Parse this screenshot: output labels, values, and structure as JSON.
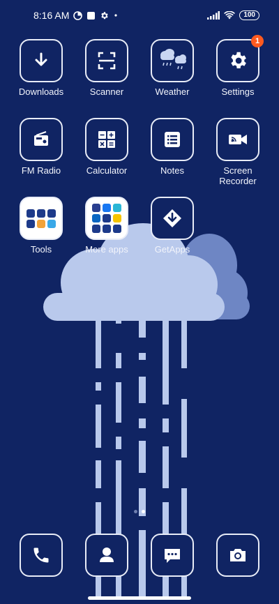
{
  "status_bar": {
    "time": "8:16 AM",
    "battery": "100"
  },
  "apps": [
    {
      "label": "Downloads",
      "icon": "download-icon"
    },
    {
      "label": "Scanner",
      "icon": "scanner-icon"
    },
    {
      "label": "Weather",
      "icon": "weather-icon"
    },
    {
      "label": "Settings",
      "icon": "gear-icon",
      "badge": "1"
    },
    {
      "label": "FM Radio",
      "icon": "radio-icon"
    },
    {
      "label": "Calculator",
      "icon": "calculator-icon"
    },
    {
      "label": "Notes",
      "icon": "notes-icon"
    },
    {
      "label": "Screen\nRecorder",
      "icon": "video-camera-icon"
    },
    {
      "label": "Tools",
      "icon": "folder-icon"
    },
    {
      "label": "More apps",
      "icon": "folder-icon"
    },
    {
      "label": "GetApps",
      "icon": "getapps-icon"
    }
  ],
  "dock": [
    {
      "name": "phone",
      "icon": "phone-icon"
    },
    {
      "name": "contacts",
      "icon": "contacts-icon"
    },
    {
      "name": "messages",
      "icon": "message-icon"
    },
    {
      "name": "camera",
      "icon": "camera-icon"
    }
  ],
  "colors": {
    "background": "#102463",
    "badge": "#ff5a1f",
    "cloud": "#b9c9ec"
  }
}
